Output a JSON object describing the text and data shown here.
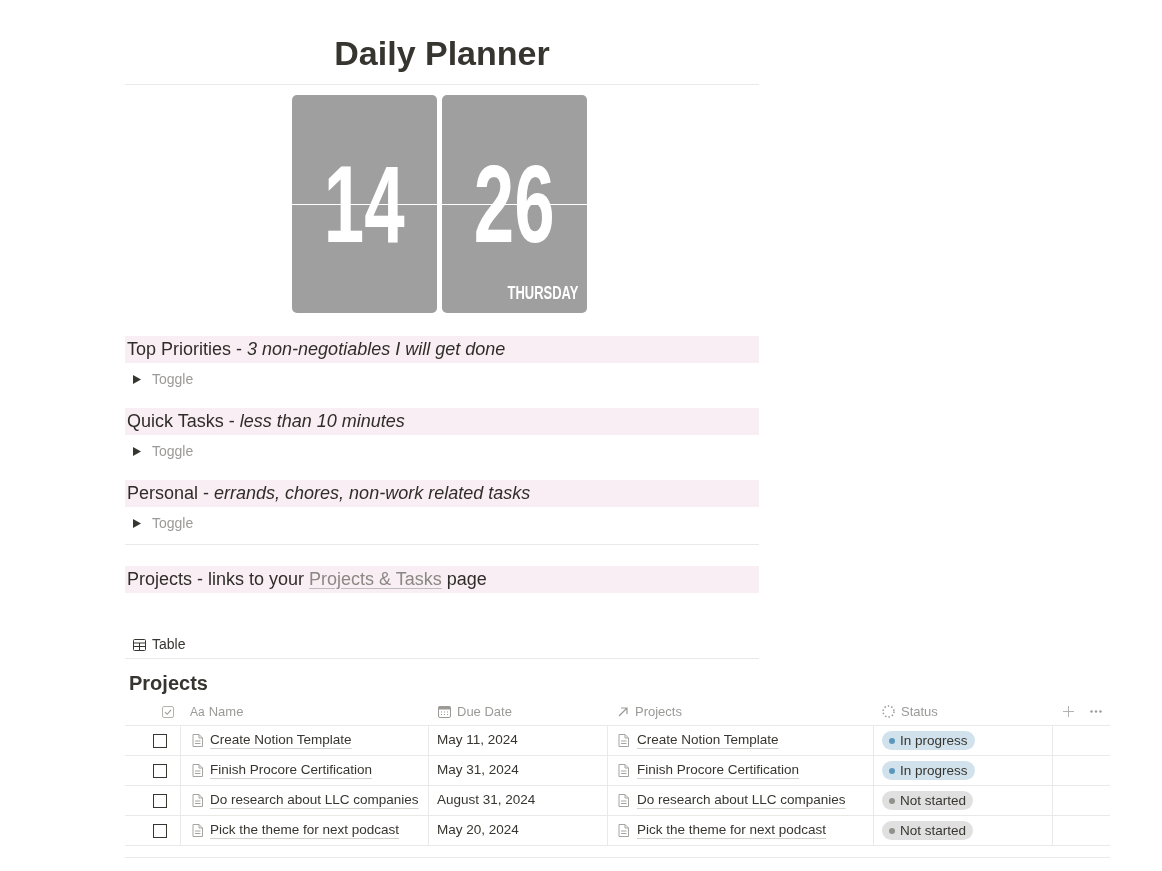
{
  "page": {
    "title": "Daily Planner"
  },
  "clock": {
    "hours": "14",
    "minutes": "26",
    "weekday": "THURSDAY"
  },
  "sections": [
    {
      "heading": "Top Priorities - *3 non-negotiables I will get done*",
      "toggle": {
        "placeholder": "Toggle",
        "expanded": false
      }
    },
    {
      "heading": "Quick Tasks - *less than 10 minutes*",
      "toggle": {
        "placeholder": "Toggle",
        "expanded": false
      }
    },
    {
      "heading": "Personal - *errands, chores, non-work related tasks*",
      "toggle": {
        "placeholder": "Toggle",
        "expanded": false
      }
    }
  ],
  "projects_heading": {
    "text_before": "Projects - links to your",
    "link": "Projects & Tasks",
    "text_after": "page"
  },
  "database": {
    "view_tab": "Table",
    "title": "Projects",
    "columns": [
      {
        "kind": "checkbox"
      },
      {
        "kind": "title",
        "glyph": "Aa",
        "label": "Name"
      },
      {
        "kind": "date",
        "label": "Due Date"
      },
      {
        "kind": "relation",
        "label": "Projects"
      },
      {
        "kind": "status",
        "label": "Status"
      }
    ],
    "rows": [
      {
        "checked": false,
        "name": "Create Notion Template",
        "due_date": "May 11, 2024",
        "project": "Create Notion Template",
        "status": {
          "label": "In progress",
          "color": "#5b97bd"
        }
      },
      {
        "checked": false,
        "name": "Finish Procore Certification",
        "due_date": "May 31, 2024",
        "project": "Finish Procore Certification",
        "status": {
          "label": "In progress",
          "color": "#5b97bd"
        }
      },
      {
        "checked": false,
        "name": "Do research about LLC companies",
        "due_date": "August 31, 2024",
        "project": "Do research about LLC companies",
        "status": {
          "label": "Not started",
          "color": "#91918e"
        }
      },
      {
        "checked": false,
        "name": "Pick the theme for next podcast",
        "due_date": "May 20, 2024",
        "project": "Pick the theme for next podcast",
        "status": {
          "label": "Not started",
          "color": "#91918e"
        }
      }
    ]
  }
}
